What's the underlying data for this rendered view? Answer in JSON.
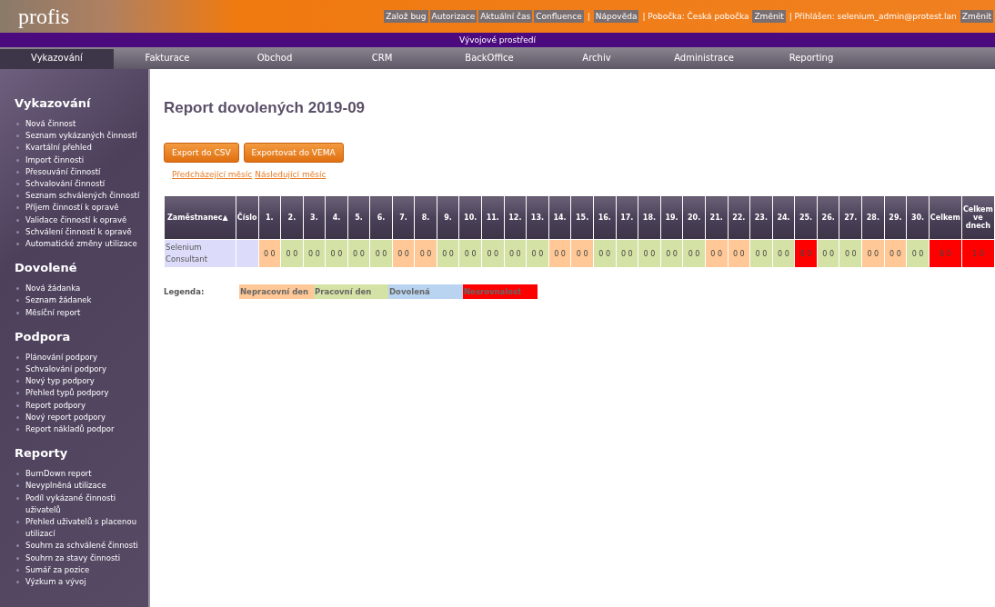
{
  "header": {
    "logo": "profis",
    "links": [
      {
        "kind": "button",
        "text": "Založ bug"
      },
      {
        "kind": "button",
        "text": "Autorizace"
      },
      {
        "kind": "button",
        "text": "Aktuální čas"
      },
      {
        "kind": "button",
        "text": "Confluence"
      },
      {
        "kind": "text",
        "text": "|"
      },
      {
        "kind": "button",
        "text": "Nápověda"
      },
      {
        "kind": "text",
        "text": "| Pobočka: Česká pobočka"
      },
      {
        "kind": "button",
        "text": "Změnit"
      },
      {
        "kind": "text",
        "text": "| Přihlášen: selenium_admin@protest.lan"
      },
      {
        "kind": "button",
        "text": "Změnit"
      }
    ]
  },
  "environment": "Vývojové prostředí",
  "tabs": [
    {
      "label": "Vykazování",
      "selected": true
    },
    {
      "label": "Fakturace",
      "selected": false
    },
    {
      "label": "Obchod",
      "selected": false
    },
    {
      "label": "CRM",
      "selected": false
    },
    {
      "label": "BackOffice",
      "selected": false
    },
    {
      "label": "Archiv",
      "selected": false
    },
    {
      "label": "Administrace",
      "selected": false
    },
    {
      "label": "Reporting",
      "selected": false
    }
  ],
  "sidebar": [
    {
      "title": "Vykazování",
      "items": [
        "Nová činnost",
        "Seznam vykázaných činností",
        "Kvartální přehled",
        "Import činnosti",
        "Přesouvání činností",
        "Schvalování činností",
        "Seznam schválených činností",
        "Příjem činností k opravě",
        "Validace činností k opravě",
        "Schválení činností k opravě",
        "Automatické změny utilizace"
      ]
    },
    {
      "title": "Dovolené",
      "items": [
        "Nová žádanka",
        "Seznam žádanek",
        "Měsíční report"
      ]
    },
    {
      "title": "Podpora",
      "items": [
        "Plánování podpory",
        "Schvalování podpory",
        "Nový typ podpory",
        "Přehled typů podpory",
        "Report podpory",
        "Nový report podpory",
        "Report nákladů podpor"
      ]
    },
    {
      "title": "Reporty",
      "items": [
        "BurnDown report",
        "Nevyplněná utilizace",
        "Podíl vykázané činnosti uživatelů",
        "Přehled uživatelů s placenou utilizací",
        "Souhrn za schválené činnosti",
        "Souhrn za stavy činnosti",
        "Sumář za pozice",
        "Výzkum a vývoj"
      ]
    }
  ],
  "title": "Report dovolených 2019-09",
  "buttons": [
    "Export do CSV",
    "Exportovat do VEMA"
  ],
  "month_links": [
    "Předcházející měsíc",
    "Následující měsíc"
  ],
  "table": {
    "columns": [
      "Zaměstnanec▲",
      "Číslo",
      "1.",
      "2.",
      "3.",
      "4.",
      "5.",
      "6.",
      "7.",
      "8.",
      "9.",
      "10.",
      "11.",
      "12.",
      "13.",
      "14.",
      "15.",
      "16.",
      "17.",
      "18.",
      "19.",
      "20.",
      "21.",
      "22.",
      "23.",
      "24.",
      "25.",
      "26.",
      "27.",
      "28.",
      "29.",
      "30.",
      "Celkem",
      "Celkem ve dnech"
    ],
    "rows": [
      {
        "cells": [
          {
            "kind": "name",
            "text": "Selenium Consultant"
          },
          {
            "kind": "number",
            "text": ""
          },
          {
            "kind": "nonwork",
            "text": "0 0"
          },
          {
            "kind": "work",
            "text": "0 0"
          },
          {
            "kind": "work",
            "text": "0 0"
          },
          {
            "kind": "work",
            "text": "0 0"
          },
          {
            "kind": "work",
            "text": "0 0"
          },
          {
            "kind": "work",
            "text": "0 0"
          },
          {
            "kind": "nonwork",
            "text": "0 0"
          },
          {
            "kind": "nonwork",
            "text": "0 0"
          },
          {
            "kind": "work",
            "text": "0 0"
          },
          {
            "kind": "work",
            "text": "0 0"
          },
          {
            "kind": "work",
            "text": "0 0"
          },
          {
            "kind": "work",
            "text": "0 0"
          },
          {
            "kind": "work",
            "text": "0 0"
          },
          {
            "kind": "nonwork",
            "text": "0 0"
          },
          {
            "kind": "nonwork",
            "text": "0 0"
          },
          {
            "kind": "work",
            "text": "0 0"
          },
          {
            "kind": "work",
            "text": "0 0"
          },
          {
            "kind": "work",
            "text": "0 0"
          },
          {
            "kind": "work",
            "text": "0 0"
          },
          {
            "kind": "work",
            "text": "0 0"
          },
          {
            "kind": "nonwork",
            "text": "0 0"
          },
          {
            "kind": "nonwork",
            "text": "0 0"
          },
          {
            "kind": "work",
            "text": "0 0"
          },
          {
            "kind": "work",
            "text": "0 0"
          },
          {
            "kind": "mismatch",
            "text": "8 0"
          },
          {
            "kind": "work",
            "text": "0 0"
          },
          {
            "kind": "work",
            "text": "0 0"
          },
          {
            "kind": "nonwork",
            "text": "0 0"
          },
          {
            "kind": "nonwork",
            "text": "0 0"
          },
          {
            "kind": "work",
            "text": "0 0"
          },
          {
            "kind": "mismatch",
            "text": "8 0"
          },
          {
            "kind": "mismatch",
            "text": "1 0"
          }
        ]
      }
    ]
  },
  "legend": {
    "label": "Legenda:",
    "items": [
      {
        "text": "Nepracovní den",
        "color": "#ffc896"
      },
      {
        "text": "Pracovní den",
        "color": "#d4e3a5"
      },
      {
        "text": "Dovolená",
        "color": "#b8d4f0"
      },
      {
        "text": "Nesrovnalost",
        "color": "#ff0000"
      }
    ]
  }
}
